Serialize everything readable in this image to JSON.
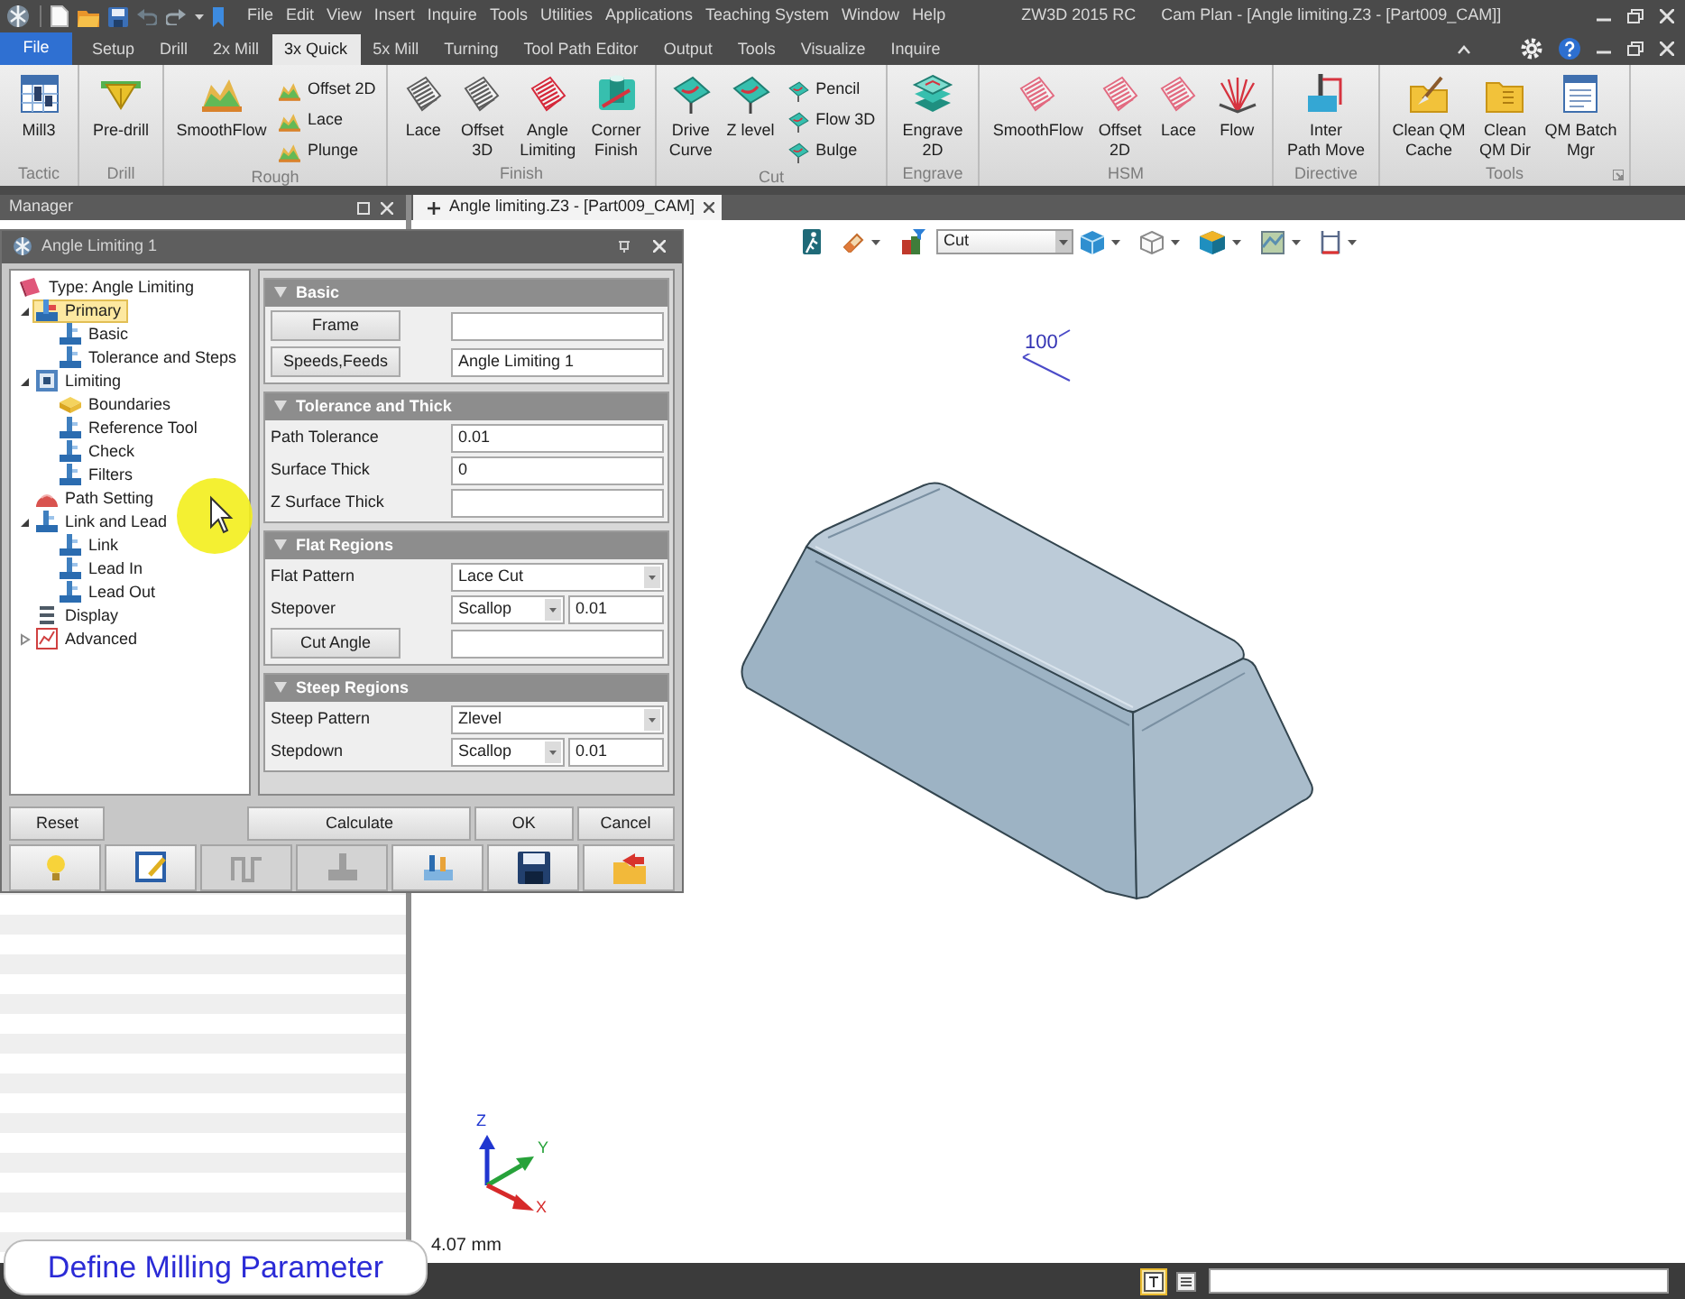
{
  "title_bar": {
    "menu": [
      "File",
      "Edit",
      "View",
      "Insert",
      "Inquire",
      "Tools",
      "Utilities",
      "Applications",
      "Teaching System",
      "Window",
      "Help"
    ],
    "app_name": "ZW3D 2015 RC",
    "document": "Cam Plan - [Angle limiting.Z3 - [Part009_CAM]]"
  },
  "ribbon_tabs": [
    {
      "label": "File",
      "kind": "app_menu",
      "selected": false
    },
    {
      "label": "Setup",
      "kind": "tab",
      "selected": false
    },
    {
      "label": "Drill",
      "kind": "tab",
      "selected": false
    },
    {
      "label": "2x Mill",
      "kind": "tab",
      "selected": false
    },
    {
      "label": "3x Quick",
      "kind": "tab",
      "selected": true
    },
    {
      "label": "5x Mill",
      "kind": "tab",
      "selected": false
    },
    {
      "label": "Turning",
      "kind": "tab",
      "selected": false
    },
    {
      "label": "Tool Path Editor",
      "kind": "tab",
      "selected": false
    },
    {
      "label": "Output",
      "kind": "tab",
      "selected": false
    },
    {
      "label": "Tools",
      "kind": "tab",
      "selected": false
    },
    {
      "label": "Visualize",
      "kind": "tab",
      "selected": false
    },
    {
      "label": "Inquire",
      "kind": "tab",
      "selected": false
    }
  ],
  "ribbon_groups": [
    {
      "label": "Tactic",
      "items": [
        {
          "kind": "large",
          "lines": [
            "Mill3"
          ]
        }
      ]
    },
    {
      "label": "Drill",
      "items": [
        {
          "kind": "large",
          "lines": [
            "Pre-drill"
          ]
        }
      ]
    },
    {
      "label": "Rough",
      "items": [
        {
          "kind": "large",
          "lines": [
            "SmoothFlow"
          ]
        },
        {
          "kind": "small",
          "label": "Offset 2D"
        },
        {
          "kind": "small",
          "label": "Lace"
        },
        {
          "kind": "small",
          "label": "Plunge"
        }
      ]
    },
    {
      "label": "Finish",
      "items": [
        {
          "kind": "large",
          "lines": [
            "Lace"
          ]
        },
        {
          "kind": "large",
          "lines": [
            "Offset",
            "3D"
          ]
        },
        {
          "kind": "large",
          "lines": [
            "Angle",
            "Limiting"
          ]
        },
        {
          "kind": "large",
          "lines": [
            "Corner",
            "Finish"
          ]
        }
      ]
    },
    {
      "label": "Cut",
      "items": [
        {
          "kind": "large",
          "lines": [
            "Drive",
            "Curve"
          ]
        },
        {
          "kind": "large",
          "lines": [
            "Z level"
          ]
        },
        {
          "kind": "small",
          "label": "Pencil"
        },
        {
          "kind": "small",
          "label": "Flow 3D"
        },
        {
          "kind": "small",
          "label": "Bulge"
        }
      ]
    },
    {
      "label": "Engrave",
      "items": [
        {
          "kind": "large",
          "lines": [
            "Engrave",
            "2D"
          ]
        }
      ]
    },
    {
      "label": "HSM",
      "items": [
        {
          "kind": "large",
          "lines": [
            "SmoothFlow"
          ]
        },
        {
          "kind": "large",
          "lines": [
            "Offset",
            "2D"
          ]
        },
        {
          "kind": "large",
          "lines": [
            "Lace"
          ]
        },
        {
          "kind": "large",
          "lines": [
            "Flow"
          ]
        }
      ]
    },
    {
      "label": "Directive",
      "items": [
        {
          "kind": "large",
          "lines": [
            "Inter",
            "Path Move"
          ]
        }
      ]
    },
    {
      "label": "Tools",
      "items": [
        {
          "kind": "large",
          "lines": [
            "Clean QM",
            "Cache"
          ]
        },
        {
          "kind": "large",
          "lines": [
            "Clean",
            "QM Dir"
          ]
        },
        {
          "kind": "large",
          "lines": [
            "QM Batch",
            "Mgr"
          ]
        }
      ]
    }
  ],
  "manager": {
    "title": "Manager"
  },
  "document_tab": {
    "label": "Angle limiting.Z3 - [Part009_CAM]"
  },
  "dialog": {
    "title": "Angle Limiting 1",
    "tree": [
      {
        "kind": "header",
        "label": "Type: Angle Limiting",
        "selected": false
      },
      {
        "kind": "node",
        "label": "Primary",
        "selected": true,
        "expanded": true,
        "children": [
          {
            "label": "Basic",
            "selected": false
          },
          {
            "label": "Tolerance and Steps",
            "selected": false
          }
        ]
      },
      {
        "kind": "node",
        "label": "Limiting",
        "selected": false,
        "expanded": true,
        "children": [
          {
            "label": "Boundaries",
            "selected": false
          },
          {
            "label": "Reference Tool",
            "selected": false
          },
          {
            "label": "Check",
            "selected": false
          },
          {
            "label": "Filters",
            "selected": false
          }
        ]
      },
      {
        "kind": "node",
        "label": "Path Setting",
        "selected": false
      },
      {
        "kind": "node",
        "label": "Link and Lead",
        "selected": false,
        "expanded": true,
        "children": [
          {
            "label": "Link",
            "selected": false
          },
          {
            "label": "Lead In",
            "selected": false
          },
          {
            "label": "Lead Out",
            "selected": false
          }
        ]
      },
      {
        "kind": "node",
        "label": "Display",
        "selected": false
      },
      {
        "kind": "node",
        "label": "Advanced",
        "selected": false,
        "expanded": false
      }
    ],
    "sections": [
      {
        "title": "Basic",
        "expanded": true,
        "rows": [
          {
            "kind": "button_field",
            "button": "Frame"
          },
          {
            "kind": "button_field",
            "button": "Speeds,Feeds",
            "value": "Angle Limiting 1"
          }
        ]
      },
      {
        "title": "Tolerance and Thick",
        "expanded": true,
        "rows": [
          {
            "kind": "field",
            "label": "Path Tolerance",
            "value": "0.01"
          },
          {
            "kind": "field",
            "label": "Surface Thick",
            "value": "0"
          },
          {
            "kind": "field",
            "label": "Z Surface Thick"
          }
        ]
      },
      {
        "title": "Flat Regions",
        "expanded": true,
        "rows": [
          {
            "kind": "dropdown",
            "label": "Flat Pattern",
            "value": "Lace Cut"
          },
          {
            "kind": "dropdown_field",
            "label": "Stepover",
            "option": "Scallop",
            "value": "0.01"
          },
          {
            "kind": "button_field",
            "button": "Cut Angle"
          }
        ]
      },
      {
        "title": "Steep Regions",
        "expanded": true,
        "rows": [
          {
            "kind": "dropdown",
            "label": "Steep Pattern",
            "value": "Zlevel"
          },
          {
            "kind": "dropdown_field",
            "label": "Stepdown",
            "option": "Scallop",
            "value": "0.01"
          }
        ]
      }
    ],
    "buttons": [
      {
        "label": "Reset"
      },
      {
        "label": "Calculate"
      },
      {
        "label": "OK"
      },
      {
        "label": "Cancel"
      }
    ],
    "tools": [
      {
        "disabled": false
      },
      {
        "disabled": false
      },
      {
        "disabled": true
      },
      {
        "disabled": true
      },
      {
        "disabled": false
      },
      {
        "disabled": false
      },
      {
        "disabled": false
      }
    ]
  },
  "viewport": {
    "display_mode": "Cut",
    "dimension": "100",
    "axis_labels": [
      "Z",
      "Y",
      "X"
    ],
    "length_readout": "4.07 mm"
  },
  "status_bar": {
    "buttons": [
      {
        "selected": true
      },
      {
        "selected": false
      }
    ]
  },
  "caption": {
    "text": "Define Milling Parameter"
  }
}
